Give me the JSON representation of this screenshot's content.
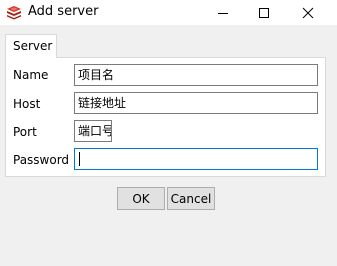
{
  "window": {
    "title": "Add server",
    "icon": "redis-cube-icon",
    "controls": {
      "minimize": "minimize-icon",
      "maximize": "maximize-icon",
      "close": "close-icon"
    }
  },
  "tabs": [
    {
      "label": "Server",
      "selected": true
    }
  ],
  "form": {
    "name_label": "Name",
    "name_value": "项目名",
    "host_label": "Host",
    "host_value": "链接地址",
    "port_label": "Port",
    "port_value": "端口号",
    "password_label": "Password",
    "password_value": ""
  },
  "buttons": {
    "ok": "OK",
    "cancel": "Cancel"
  },
  "colors": {
    "focus_border": "#0078d7",
    "icon_red": "#d82c20"
  }
}
